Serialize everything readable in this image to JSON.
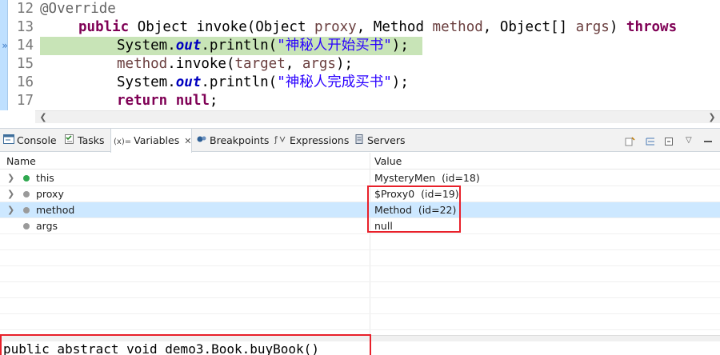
{
  "editor": {
    "lines": [
      {
        "num": "12",
        "tokens": [
          {
            "t": "@Override",
            "c": "ann"
          }
        ]
      },
      {
        "num": "13",
        "tokens": [
          {
            "t": "public",
            "c": "kw"
          },
          {
            "t": " ",
            "c": "plain"
          },
          {
            "t": "Object invoke(Object ",
            "c": "plain"
          },
          {
            "t": "proxy",
            "c": "var"
          },
          {
            "t": ", Method ",
            "c": "plain"
          },
          {
            "t": "method",
            "c": "var"
          },
          {
            "t": ", Object[] ",
            "c": "plain"
          },
          {
            "t": "args",
            "c": "var"
          },
          {
            "t": ") ",
            "c": "plain"
          },
          {
            "t": "throws",
            "c": "kw"
          }
        ]
      },
      {
        "num": "14",
        "tokens": [
          {
            "t": "System.",
            "c": "plain"
          },
          {
            "t": "out",
            "c": "field"
          },
          {
            "t": ".println(",
            "c": "plain"
          },
          {
            "t": "\"神秘人开始买书\"",
            "c": "str"
          },
          {
            "t": ");",
            "c": "plain"
          }
        ]
      },
      {
        "num": "15",
        "tokens": [
          {
            "t": "method",
            "c": "var"
          },
          {
            "t": ".invoke(",
            "c": "plain"
          },
          {
            "t": "target",
            "c": "var"
          },
          {
            "t": ", ",
            "c": "plain"
          },
          {
            "t": "args",
            "c": "var"
          },
          {
            "t": ");",
            "c": "plain"
          }
        ]
      },
      {
        "num": "16",
        "tokens": [
          {
            "t": "System.",
            "c": "plain"
          },
          {
            "t": "out",
            "c": "field"
          },
          {
            "t": ".println(",
            "c": "plain"
          },
          {
            "t": "\"神秘人完成买书\"",
            "c": "str"
          },
          {
            "t": ");",
            "c": "plain"
          }
        ]
      },
      {
        "num": "17",
        "tokens": [
          {
            "t": "return",
            "c": "kw"
          },
          {
            "t": " ",
            "c": "plain"
          },
          {
            "t": "null",
            "c": "kw"
          },
          {
            "t": ";",
            "c": "plain"
          }
        ]
      }
    ],
    "current_line": "14",
    "debug_arrow": "»"
  },
  "tabs": [
    {
      "label": "Console",
      "icon": "console-icon"
    },
    {
      "label": "Tasks",
      "icon": "tasks-icon"
    },
    {
      "label": "Variables",
      "icon": "variables-icon",
      "active": true,
      "prefix": "(x)="
    },
    {
      "label": "Breakpoints",
      "icon": "breakpoints-icon"
    },
    {
      "label": "Expressions",
      "icon": "expressions-icon"
    },
    {
      "label": "Servers",
      "icon": "servers-icon"
    }
  ],
  "variables": {
    "header": {
      "name": "Name",
      "value": "Value"
    },
    "rows": [
      {
        "name": "this",
        "value": "MysteryMen  (id=18)",
        "expandable": true,
        "dot_color": "#2fa84f"
      },
      {
        "name": "proxy",
        "value": "$Proxy0  (id=19)",
        "expandable": true,
        "dot_color": "#9a9a9a"
      },
      {
        "name": "method",
        "value": "Method  (id=22)",
        "expandable": true,
        "dot_color": "#9a9a9a",
        "selected": true
      },
      {
        "name": "args",
        "value": "null",
        "expandable": false,
        "dot_color": "#9a9a9a"
      }
    ]
  },
  "detail": {
    "text": "public abstract void demo3.Book.buyBook()"
  },
  "colors": {
    "highlight_box": "#e8202a",
    "selection": "#cde8ff",
    "current_line": "#c8e4b7"
  }
}
